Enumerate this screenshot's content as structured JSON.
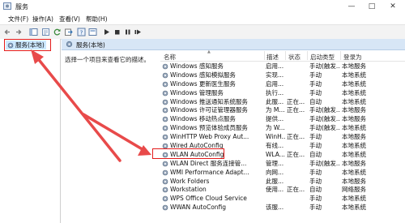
{
  "window": {
    "title": "服务"
  },
  "window_buttons": {
    "minimize": "—",
    "maximize": "□",
    "close": "✕"
  },
  "menu": [
    "文件(F)",
    "操作(A)",
    "查看(V)",
    "帮助(H)"
  ],
  "toolbar_icons": [
    "back-icon",
    "forward-icon",
    "console-tree-icon",
    "properties-icon",
    "refresh-icon",
    "export-icon",
    "help-icon",
    "view-icon",
    "play-icon",
    "stop-icon",
    "pause-icon",
    "restart-icon"
  ],
  "tree": {
    "selected_label": "服务(本地)"
  },
  "pane": {
    "header": "服务(本地)",
    "description": "选择一个项目来查看它的描述。"
  },
  "columns": {
    "name": "名称",
    "description": "描述",
    "status": "状态",
    "startup": "启动类型",
    "logon": "登录为"
  },
  "services": [
    {
      "name": "Windows 感知服务",
      "description": "启用...",
      "status": "",
      "startup": "手动(触发...",
      "logon": "本地服务"
    },
    {
      "name": "Windows 感知模拟服务",
      "description": "实现...",
      "status": "",
      "startup": "手动",
      "logon": "本地系统"
    },
    {
      "name": "Windows 更新医生服务",
      "description": "启用...",
      "status": "",
      "startup": "手动",
      "logon": "本地系统"
    },
    {
      "name": "Windows 管理服务",
      "description": "执行...",
      "status": "",
      "startup": "手动",
      "logon": "本地系统"
    },
    {
      "name": "Windows 推送通知系统服务",
      "description": "此服...",
      "status": "正在...",
      "startup": "自动",
      "logon": "本地系统"
    },
    {
      "name": "Windows 许可证管理器服务",
      "description": "为 M...",
      "status": "正在...",
      "startup": "手动(触发...",
      "logon": "本地服务"
    },
    {
      "name": "Windows 移动热点服务",
      "description": "提供...",
      "status": "",
      "startup": "手动(触发...",
      "logon": "本地服务"
    },
    {
      "name": "Windows 预览体验成员服务",
      "description": "为 W...",
      "status": "",
      "startup": "手动(触发...",
      "logon": "本地系统"
    },
    {
      "name": "WinHTTP Web Proxy Aut...",
      "description": "WinH...",
      "status": "正在...",
      "startup": "手动",
      "logon": "本地服务"
    },
    {
      "name": "Wired AutoConfig",
      "description": "有线...",
      "status": "",
      "startup": "手动",
      "logon": "本地系统"
    },
    {
      "name": "WLAN AutoConfig",
      "description": "WLA...",
      "status": "正在...",
      "startup": "自动",
      "logon": "本地系统"
    },
    {
      "name": "WLAN Direct 服务连接管...",
      "description": "管理...",
      "status": "",
      "startup": "手动(触发...",
      "logon": "本地服务"
    },
    {
      "name": "WMI Performance Adapt...",
      "description": "向网...",
      "status": "",
      "startup": "手动",
      "logon": "本地系统"
    },
    {
      "name": "Work Folders",
      "description": "此服...",
      "status": "",
      "startup": "手动",
      "logon": "本地服务"
    },
    {
      "name": "Workstation",
      "description": "使用...",
      "status": "正在...",
      "startup": "自动",
      "logon": "网络服务"
    },
    {
      "name": "WPS Office Cloud Service",
      "description": "",
      "status": "",
      "startup": "手动",
      "logon": "本地系统"
    },
    {
      "name": "WWAN AutoConfig",
      "description": "该服...",
      "status": "",
      "startup": "手动",
      "logon": "本地系统"
    }
  ]
}
